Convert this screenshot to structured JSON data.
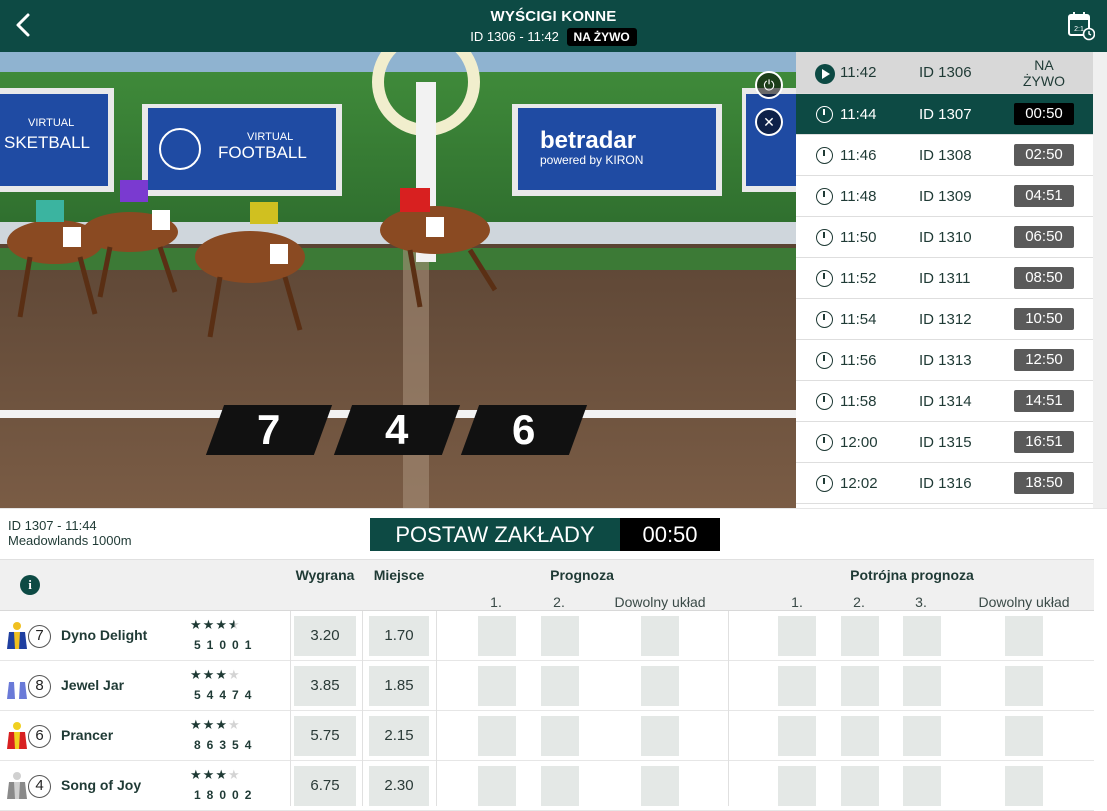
{
  "header": {
    "title": "WYŚCIGI KONNE",
    "subtitle": "ID 1306 - 11:42",
    "live_badge": "NA ŻYWO"
  },
  "video": {
    "banners": [
      "VIRTUAL",
      "SKETBALL",
      "VIRTUAL",
      "FOOTBALL",
      "betradar",
      "powered by KIRON"
    ],
    "positions": [
      "7",
      "4",
      "6"
    ]
  },
  "schedule": [
    {
      "time": "11:42",
      "id": "ID 1306",
      "status": "NA ŻYWO",
      "state": "live"
    },
    {
      "time": "11:44",
      "id": "ID 1307",
      "status": "00:50",
      "state": "active"
    },
    {
      "time": "11:46",
      "id": "ID 1308",
      "status": "02:50",
      "state": "upcoming"
    },
    {
      "time": "11:48",
      "id": "ID 1309",
      "status": "04:51",
      "state": "upcoming"
    },
    {
      "time": "11:50",
      "id": "ID 1310",
      "status": "06:50",
      "state": "upcoming"
    },
    {
      "time": "11:52",
      "id": "ID 1311",
      "status": "08:50",
      "state": "upcoming"
    },
    {
      "time": "11:54",
      "id": "ID 1312",
      "status": "10:50",
      "state": "upcoming"
    },
    {
      "time": "11:56",
      "id": "ID 1313",
      "status": "12:50",
      "state": "upcoming"
    },
    {
      "time": "11:58",
      "id": "ID 1314",
      "status": "14:51",
      "state": "upcoming"
    },
    {
      "time": "12:00",
      "id": "ID 1315",
      "status": "16:51",
      "state": "upcoming"
    },
    {
      "time": "12:02",
      "id": "ID 1316",
      "status": "18:50",
      "state": "upcoming"
    }
  ],
  "race_info": {
    "line1": "ID 1307 - 11:44",
    "line2": "Meadowlands 1000m",
    "bet_label": "POSTAW ZAKŁADY",
    "timer": "00:50"
  },
  "table": {
    "headers": {
      "win": "Wygrana",
      "place": "Miejsce",
      "forecast": "Prognoza",
      "tricast": "Potrójna prognoza"
    },
    "forecast_sub": [
      "1.",
      "2.",
      "Dowolny układ"
    ],
    "tricast_sub": [
      "1.",
      "2.",
      "3.",
      "Dowolny układ"
    ],
    "runners": [
      {
        "number": "7",
        "name": "Dyno Delight",
        "rating": 3.5,
        "form": "51001",
        "win": "3.20",
        "place": "1.70",
        "silk": [
          "#1f3fa0",
          "#f0c020"
        ]
      },
      {
        "number": "8",
        "name": "Jewel Jar",
        "rating": 3,
        "form": "54474",
        "win": "3.85",
        "place": "1.85",
        "silk": [
          "#6a7ad8",
          "#ffffff"
        ]
      },
      {
        "number": "6",
        "name": "Prancer",
        "rating": 3,
        "form": "86354",
        "win": "5.75",
        "place": "2.15",
        "silk": [
          "#d82020",
          "#f0d020"
        ]
      },
      {
        "number": "4",
        "name": "Song of Joy",
        "rating": 3,
        "form": "18002",
        "win": "6.75",
        "place": "2.30",
        "silk": [
          "#8a8a8a",
          "#d0d0d0"
        ]
      }
    ]
  },
  "colors": {
    "brand": "#0d4a44",
    "timer_bg": "#000000",
    "countdown_bg": "#5a5a5a",
    "cell_bg": "#e4e8e6"
  }
}
